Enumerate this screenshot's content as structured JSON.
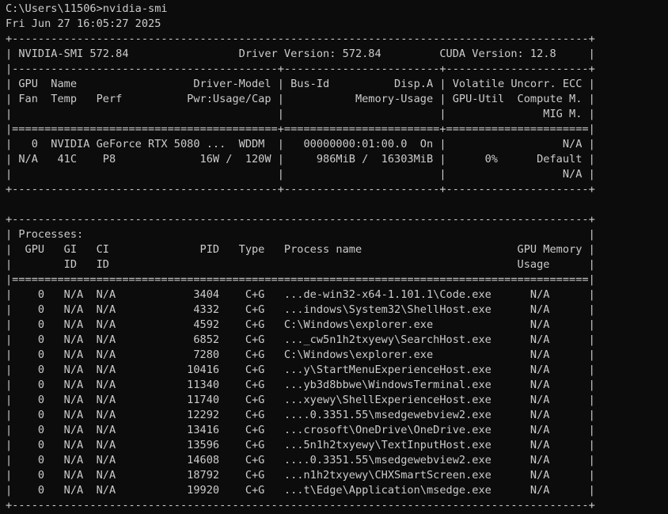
{
  "terminal": {
    "lines": [
      "C:\\Users\\11506>nvidia-smi",
      "Fri Jun 27 16:05:27 2025",
      "+-----------------------------------------------------------------------------------------+",
      "| NVIDIA-SMI 572.84                 Driver Version: 572.84         CUDA Version: 12.8     |",
      "|-----------------------------------------+------------------------+----------------------+",
      "| GPU  Name                  Driver-Model | Bus-Id          Disp.A | Volatile Uncorr. ECC |",
      "| Fan  Temp   Perf          Pwr:Usage/Cap |           Memory-Usage | GPU-Util  Compute M. |",
      "|                                         |                        |               MIG M. |",
      "|=========================================+========================+======================|",
      "|   0  NVIDIA GeForce RTX 5080 ...  WDDM  |   00000000:01:00.0  On |                  N/A |",
      "| N/A   41C    P8             16W /  120W |     986MiB /  16303MiB |      0%      Default |",
      "|                                         |                        |                  N/A |",
      "+-----------------------------------------+------------------------+----------------------+",
      "",
      "+-----------------------------------------------------------------------------------------+",
      "| Processes:                                                                              |",
      "|  GPU   GI   CI              PID   Type   Process name                        GPU Memory |",
      "|        ID   ID                                                               Usage      |",
      "|=========================================================================================|",
      "|    0   N/A  N/A            3404    C+G   ...de-win32-x64-1.101.1\\Code.exe      N/A      |",
      "|    0   N/A  N/A            4332    C+G   ...indows\\System32\\ShellHost.exe      N/A      |",
      "|    0   N/A  N/A            4592    C+G   C:\\Windows\\explorer.exe               N/A      |",
      "|    0   N/A  N/A            6852    C+G   ..._cw5n1h2txyewy\\SearchHost.exe      N/A      |",
      "|    0   N/A  N/A            7280    C+G   C:\\Windows\\explorer.exe               N/A      |",
      "|    0   N/A  N/A           10416    C+G   ...y\\StartMenuExperienceHost.exe      N/A      |",
      "|    0   N/A  N/A           11340    C+G   ...yb3d8bbwe\\WindowsTerminal.exe      N/A      |",
      "|    0   N/A  N/A           11740    C+G   ...xyewy\\ShellExperienceHost.exe      N/A      |",
      "|    0   N/A  N/A           12292    C+G   ....0.3351.55\\msedgewebview2.exe      N/A      |",
      "|    0   N/A  N/A           13416    C+G   ...crosoft\\OneDrive\\OneDrive.exe      N/A      |",
      "|    0   N/A  N/A           13596    C+G   ...5n1h2txyewy\\TextInputHost.exe      N/A      |",
      "|    0   N/A  N/A           14608    C+G   ....0.3351.55\\msedgewebview2.exe      N/A      |",
      "|    0   N/A  N/A           18792    C+G   ...n1h2txyewy\\CHXSmartScreen.exe      N/A      |",
      "|    0   N/A  N/A           19920    C+G   ...t\\Edge\\Application\\msedge.exe      N/A      |",
      "+-----------------------------------------------------------------------------------------+"
    ],
    "colors": {
      "background": "#0c0c0c",
      "foreground": "#cccccc"
    }
  }
}
